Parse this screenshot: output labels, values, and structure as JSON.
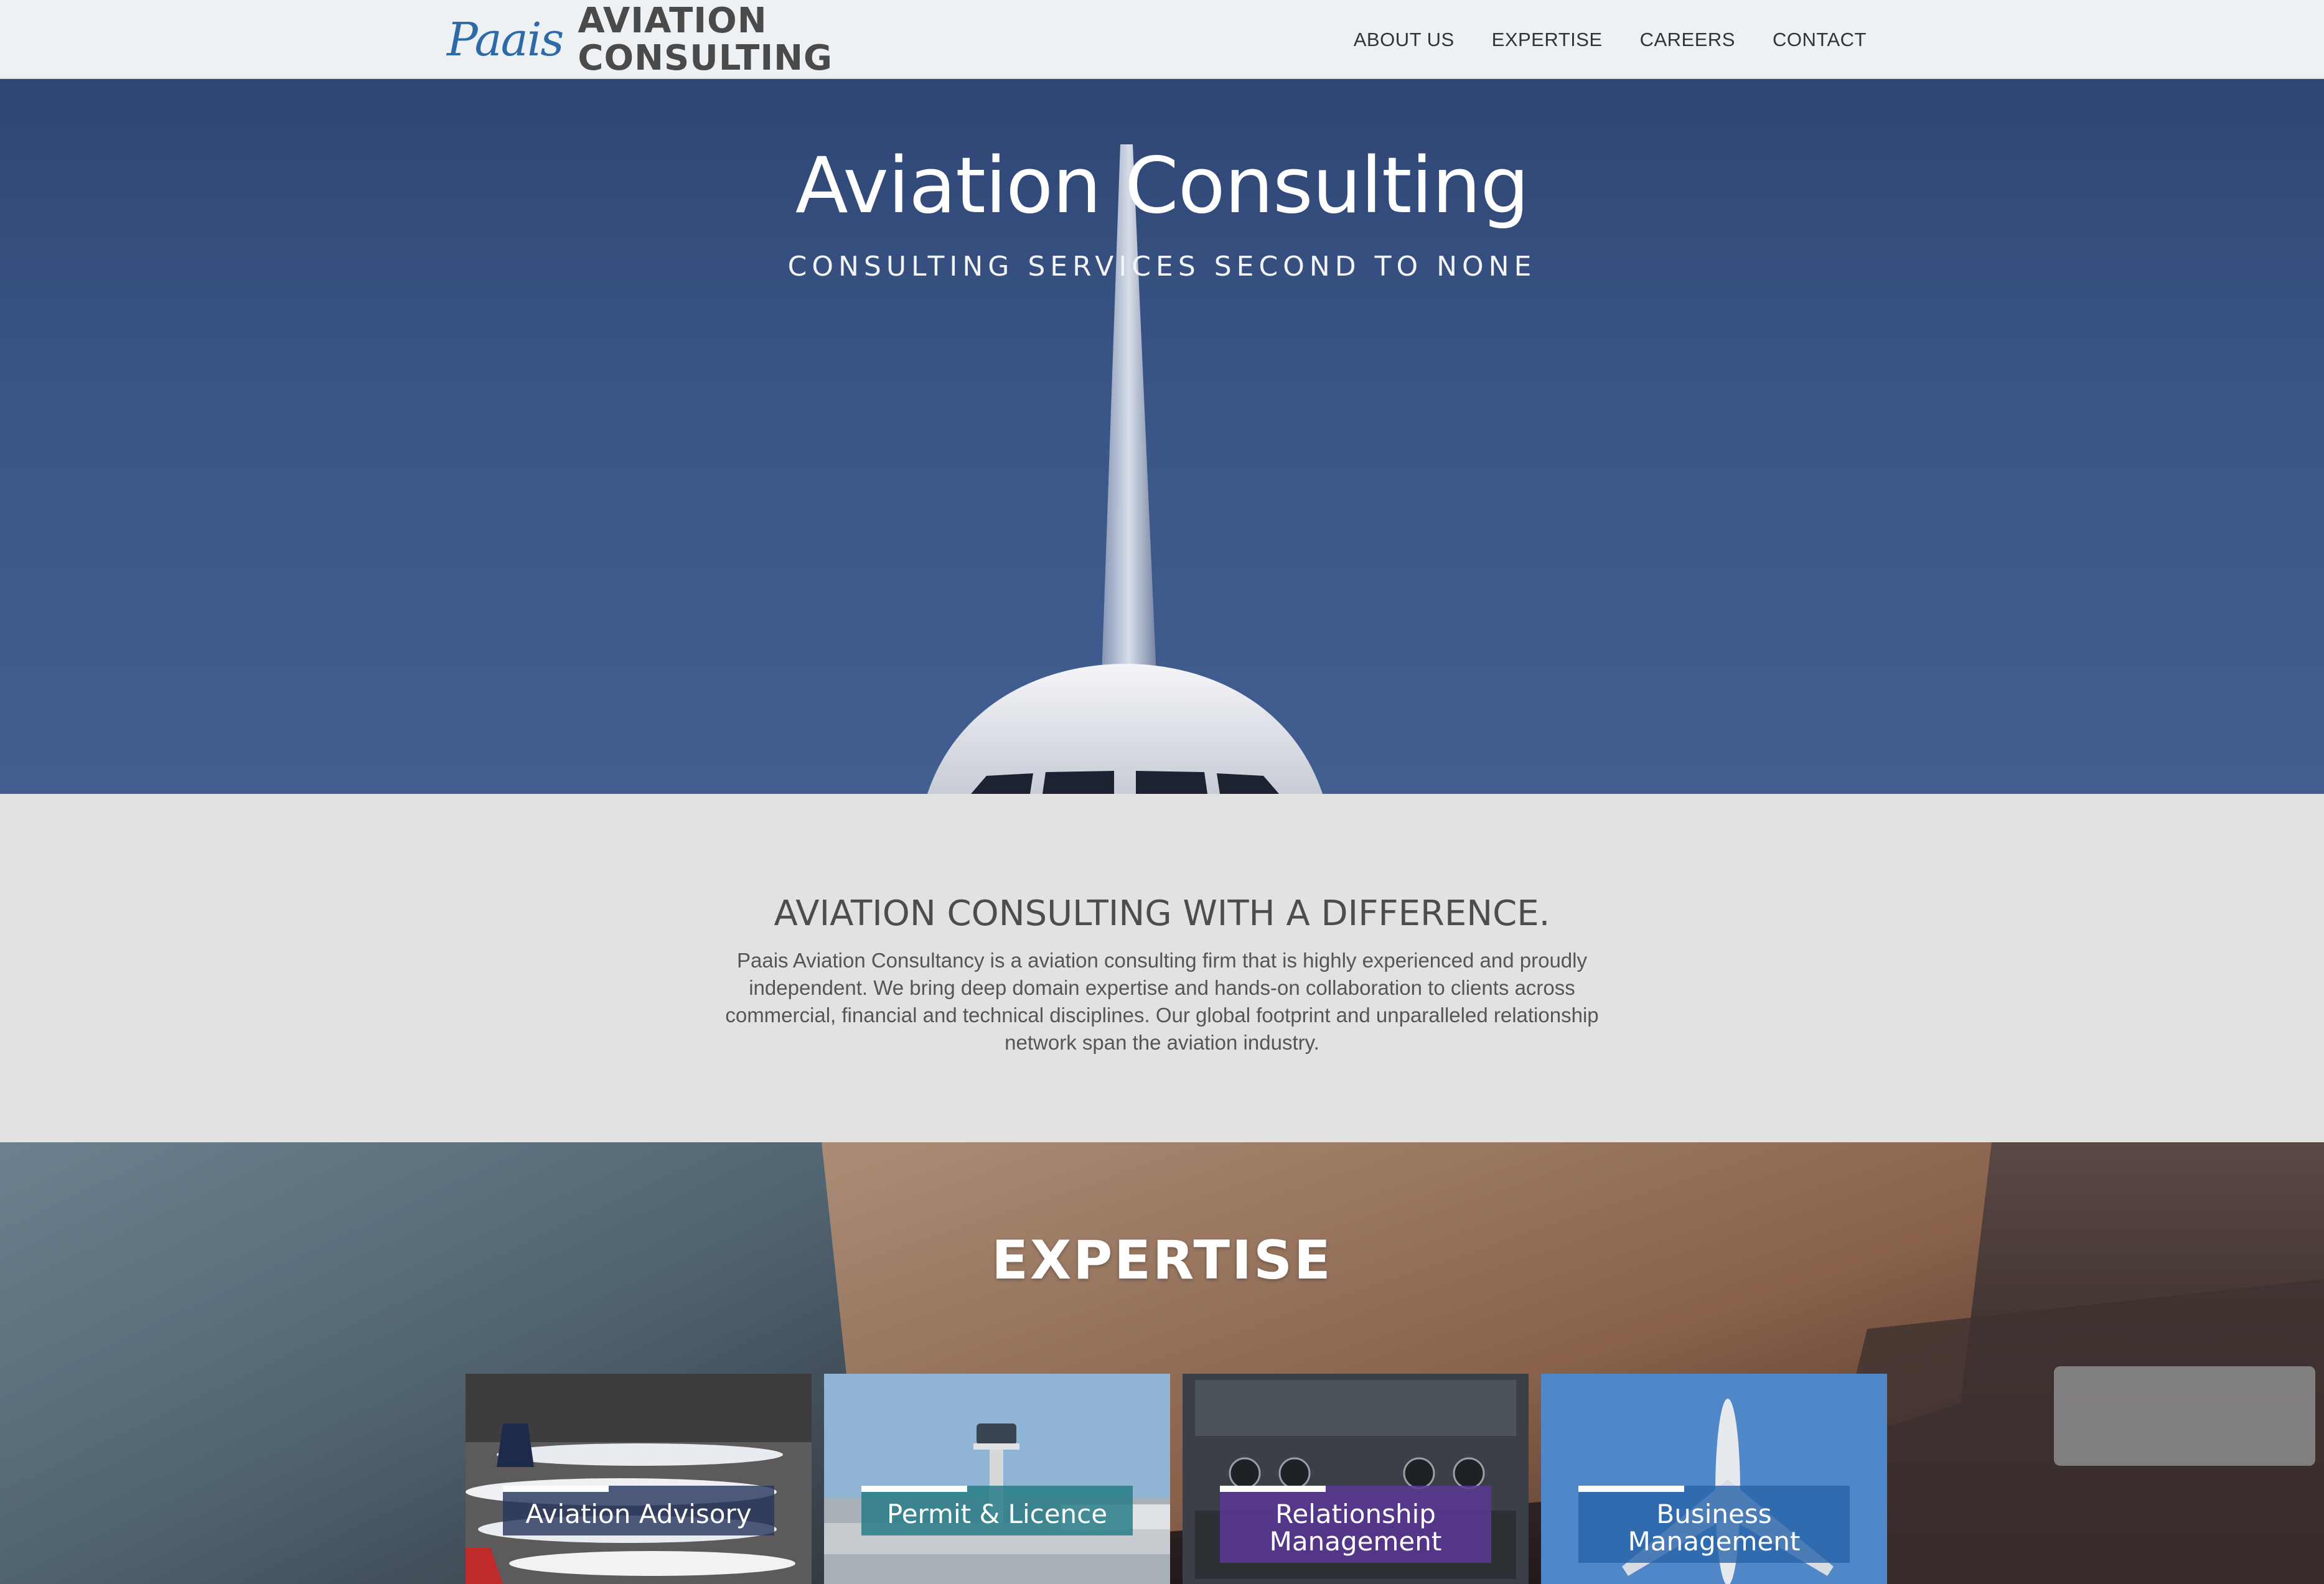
{
  "header": {
    "logo_script": "Paais",
    "logo_line1": "AVIATION",
    "logo_line2": "CONSULTING",
    "nav": [
      "ABOUT US",
      "EXPERTISE",
      "CAREERS",
      "CONTACT"
    ]
  },
  "hero": {
    "title": "Aviation Consulting",
    "subtitle": "CONSULTING SERVICES SECOND TO NONE"
  },
  "intro": {
    "heading": "AVIATION CONSULTING WITH A DIFFERENCE.",
    "text": "Paais Aviation Consultancy is a aviation consulting firm that is highly experienced and proudly independent. We bring deep domain expertise and hands-on collaboration to clients across commercial, financial and technical disciplines. Our global footprint and unparalleled relationship network span the aviation industry."
  },
  "expertise": {
    "title": "EXPERTISE",
    "cards": [
      {
        "line1": "Aviation Advisory",
        "line2": ""
      },
      {
        "line1": "Permit & Licence",
        "line2": ""
      },
      {
        "line1": "Relationship",
        "line2": "Management"
      },
      {
        "line1": "Business",
        "line2": "Management"
      }
    ]
  },
  "colors": {
    "brand_blue": "#2f6aa8",
    "header_bg": "#eef1f4",
    "hero_blue": "#3a5687",
    "intro_bg": "#e2e2e2"
  }
}
